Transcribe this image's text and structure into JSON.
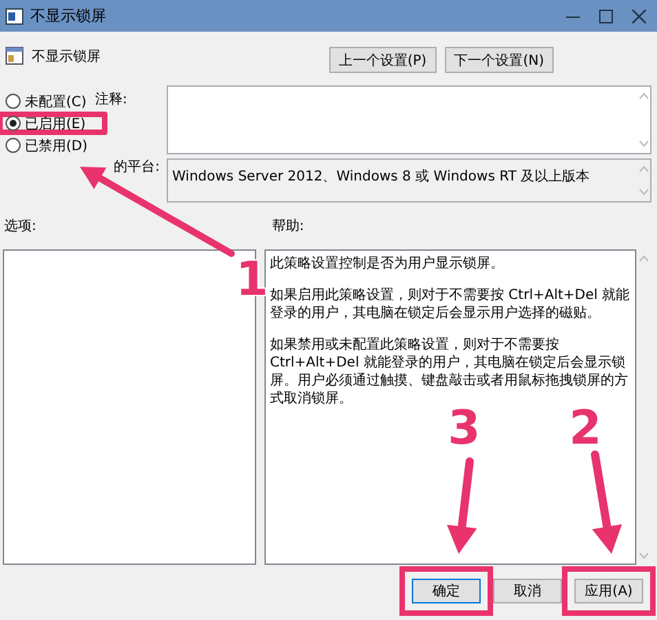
{
  "window": {
    "title": "不显示锁屏"
  },
  "policy": {
    "name": "不显示锁屏"
  },
  "nav_buttons": [
    "上一个设置(P)",
    "下一个设置(N)"
  ],
  "state_options": [
    {
      "label": "未配置(C)",
      "selected": false,
      "highlighted": false
    },
    {
      "label": "已启用(E)",
      "selected": true,
      "highlighted": true
    },
    {
      "label": "已禁用(D)",
      "selected": false,
      "highlighted": false
    }
  ],
  "comment": {
    "label": "注释:"
  },
  "platform": {
    "label": "的平台:",
    "value": "Windows Server 2012、Windows 8 或 Windows RT 及以上版本"
  },
  "options": {
    "label": "选项:"
  },
  "help": {
    "label": "帮助:",
    "paragraphs": [
      "此策略设置控制是否为用户显示锁屏。",
      "如果启用此策略设置，则对于不需要按 Ctrl+Alt+Del 就能登录的用户，其电脑在锁定后会显示用户选择的磁贴。",
      "如果禁用或未配置此策略设置，则对于不需要按 Ctrl+Alt+Del 就能登录的用户，其电脑在锁定后会显示锁屏。用户必须通过触摸、键盘敲击或者用鼠标拖拽锁屏的方式取消锁屏。"
    ]
  },
  "buttons": [
    {
      "label": "确定",
      "default": true,
      "highlighted": true
    },
    {
      "label": "取消",
      "default": false,
      "highlighted": false
    },
    {
      "label": "应用(A)",
      "default": false,
      "highlighted": true
    }
  ],
  "annotations": [
    {
      "number": "1"
    },
    {
      "number": "2"
    },
    {
      "number": "3"
    }
  ]
}
